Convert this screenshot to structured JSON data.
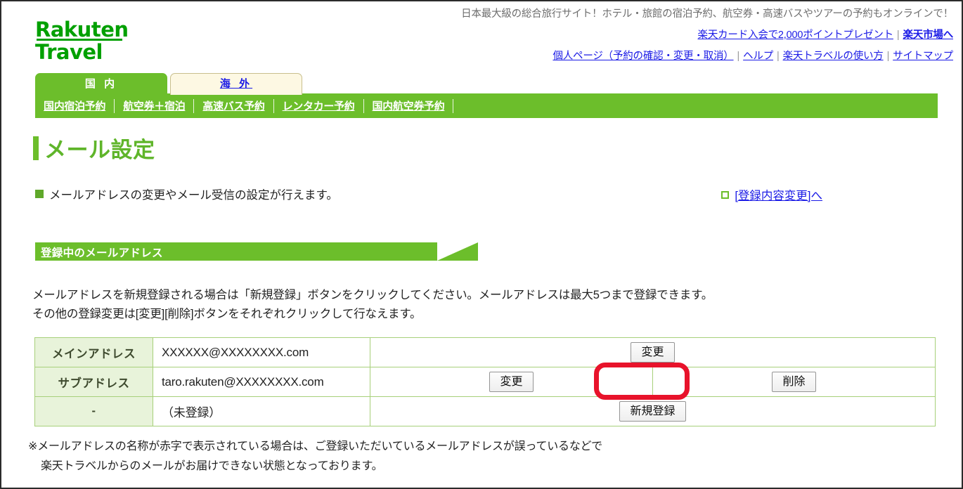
{
  "header": {
    "logo_line1": "Rakuten",
    "logo_line2": "Travel",
    "tagline": "日本最大級の総合旅行サイト！ホテル・旅館の宿泊予約、航空券・高速バスやツアーの予約もオンラインで！",
    "links_row1": [
      {
        "label": "楽天カード入会で2,000ポイントプレゼント",
        "bold": false
      },
      {
        "label": "楽天市場へ",
        "bold": true
      }
    ],
    "links_row2": [
      {
        "label": "個人ページ（予約の確認・変更・取消）",
        "bold": false
      },
      {
        "label": "ヘルプ",
        "bold": false
      },
      {
        "label": "楽天トラベルの使い方",
        "bold": false
      },
      {
        "label": "サイトマップ",
        "bold": false
      }
    ],
    "separator": "|"
  },
  "tabs": [
    {
      "label": "国 内",
      "active": true
    },
    {
      "label": "海 外",
      "active": false
    }
  ],
  "nav": [
    {
      "label": "国内宿泊予約",
      "current": true
    },
    {
      "label": "航空券＋宿泊",
      "current": false
    },
    {
      "label": "高速バス予約",
      "current": false
    },
    {
      "label": "レンタカー予約",
      "current": false
    },
    {
      "label": "国内航空券予約",
      "current": false
    }
  ],
  "page": {
    "title": "メール設定",
    "description": "メールアドレスの変更やメール受信の設定が行えます。",
    "change_registration_link": "[登録内容変更]へ"
  },
  "section": {
    "banner_title": "登録中のメールアドレス",
    "intro_line1": "メールアドレスを新規登録される場合は「新規登録」ボタンをクリックしてください。メールアドレスは最大5つまで登録できます。",
    "intro_line2": "その他の登録変更は[変更][削除]ボタンをそれぞれクリックして行なえます。"
  },
  "table": {
    "rows": [
      {
        "label": "メインアドレス",
        "address": "XXXXXX@XXXXXXXX.com",
        "primary_button": "変更",
        "secondary_button": ""
      },
      {
        "label": "サブアドレス",
        "address": "taro.rakuten@XXXXXXXX.com",
        "primary_button": "変更",
        "secondary_button": "削除"
      },
      {
        "label": "-",
        "address": "（未登録）",
        "primary_button": "新規登録",
        "secondary_button": ""
      }
    ]
  },
  "note": {
    "line1": "※メールアドレスの名称が赤字で表示されている場合は、ご登録いただいているメールアドレスが誤っているなどで",
    "line2": "楽天トラベルからのメールがお届けできない状態となっております。"
  },
  "annotation": {
    "highlight_target": "変更",
    "highlight_color": "#e8132b"
  },
  "colors": {
    "brand_green": "#6cbe2b",
    "logo_green": "#00a000",
    "title_green": "#5fb52a",
    "link_blue": "#1a1ae6",
    "table_header_bg": "#e8f3da",
    "table_border": "#a7d07a",
    "tab_inactive_bg": "#fdf8e3"
  }
}
